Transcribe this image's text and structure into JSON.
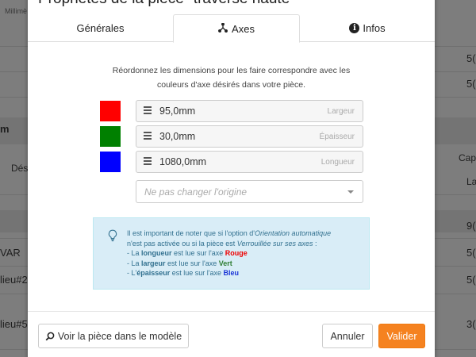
{
  "background": {
    "col_header": "Millimè",
    "row_m": "m",
    "label_des": "Dési",
    "label_cap": "Cap",
    "label_la": "La",
    "row_var": "VAR",
    "row_lieu2": "lieu#2",
    "row_lieu5": "lieu#5",
    "num_1": "5(",
    "num_2": "5(",
    "num_3": "9(",
    "num_4": "5(",
    "num_5": "5(",
    "num_6": "3("
  },
  "modal": {
    "title": "Propriétés de la pièce \"traverse haute\"",
    "tabs": [
      {
        "label": "Générales",
        "icon": ""
      },
      {
        "label": "Axes",
        "icon": "axes-icon"
      },
      {
        "label": "Infos",
        "icon": "info-circle-icon"
      }
    ],
    "description_line1": "Réordonnez les dimensions pour les faire correspondre avec les",
    "description_line2": "couleurs d'axe désirés dans votre pièce.",
    "dimensions": [
      {
        "color": "#ff0000",
        "value": "95,0mm",
        "label": "Largeur"
      },
      {
        "color": "#008000",
        "value": "30,0mm",
        "label": "Épaisseur"
      },
      {
        "color": "#0000ff",
        "value": "1080,0mm",
        "label": "Longueur"
      }
    ],
    "origin_select": {
      "placeholder": "Ne pas changer l'origine"
    },
    "note": {
      "line1": "Il est important de noter que si l'option d'",
      "line1_em": "Orientation automatique",
      "line2_a": "n'est pas activée ou si la pièce est ",
      "line2_em": "Verrouillée sur ses axes",
      "line2_b": " :",
      "item1_a": "- La ",
      "item1_b": "longueur",
      "item1_c": " est lue sur l'axe ",
      "item1_d": "Rouge",
      "item2_a": "- La ",
      "item2_b": "largeur",
      "item2_c": " est lue sur l'axe ",
      "item2_d": "Vert",
      "item3_a": "- L'",
      "item3_b": "épaisseur",
      "item3_c": " est lue sur l'axe ",
      "item3_d": "Bleu"
    },
    "buttons": {
      "view_in_model": "Voir la pièce dans le modèle",
      "cancel": "Annuler",
      "validate": "Valider"
    }
  }
}
